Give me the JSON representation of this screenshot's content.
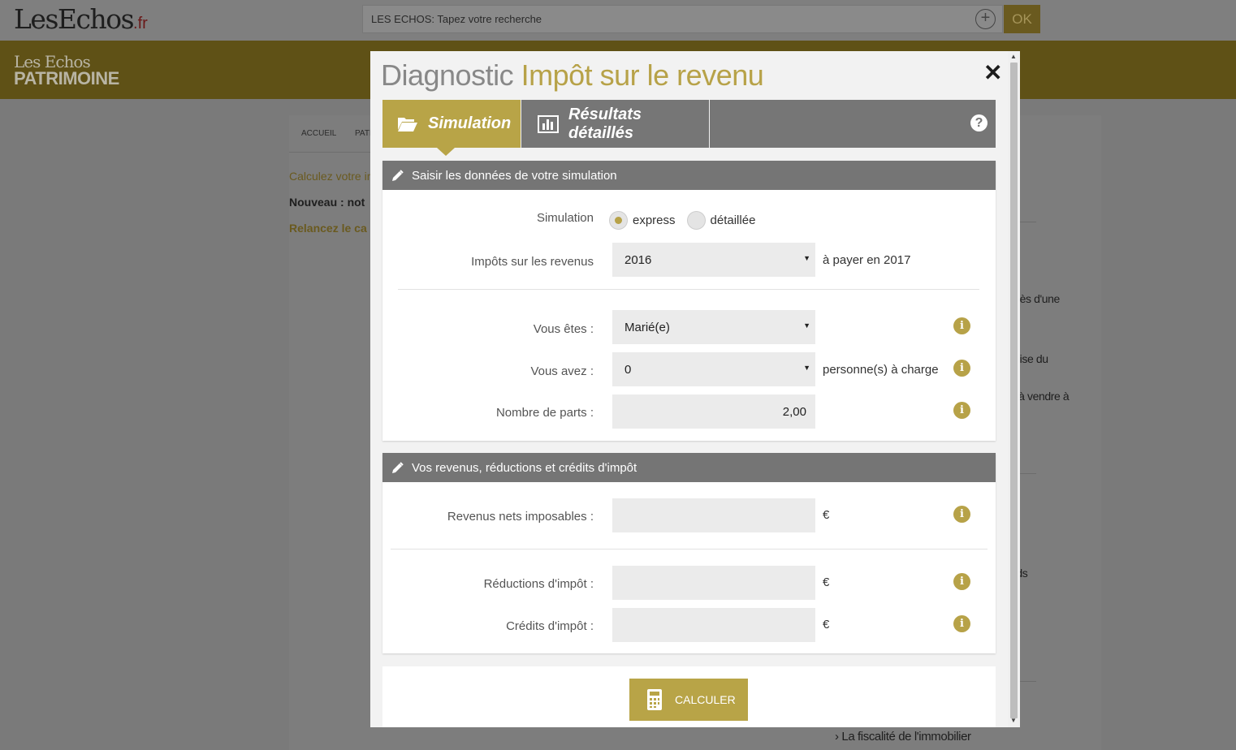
{
  "site": {
    "logo": "LesEchos",
    "logo_suffix": ".fr",
    "search_placeholder": "LES ECHOS: Tapez votre recherche",
    "ok_label": "OK",
    "section_logo_line1": "Les Echos",
    "section_logo_line2": "PATRIMOINE"
  },
  "background": {
    "breadcrumb": [
      "ACCUEIL",
      "PATR"
    ],
    "link_text": "Calculez votre in",
    "bold_text": "Nouveau : not",
    "relance_text": "Relancez le ca",
    "side_snippets": [
      "près d'une",
      "prise du",
      "s à vendre à",
      "nds"
    ],
    "bottom_link": "La fiscalité de l'immobilier"
  },
  "modal": {
    "title_part1": "Diagnostic",
    "title_part2": "Impôt sur le revenu",
    "tabs": [
      {
        "label": "Simulation",
        "active": true
      },
      {
        "label": "Résultats détaillés",
        "active": false
      }
    ],
    "section1": {
      "heading": "Saisir les données de votre simulation",
      "simulation_label": "Simulation",
      "simulation_options": [
        "express",
        "détaillée"
      ],
      "simulation_selected": "express",
      "impots_label": "Impôts sur les revenus",
      "impots_value": "2016",
      "impots_after": "à payer en 2017",
      "vous_etes_label": "Vous êtes :",
      "vous_etes_value": "Marié(e)",
      "vous_avez_label": "Vous avez :",
      "vous_avez_value": "0",
      "vous_avez_after": "personne(s) à charge",
      "parts_label": "Nombre de parts :",
      "parts_value": "2,00"
    },
    "section2": {
      "heading": "Vos revenus, réductions et crédits d'impôt",
      "revenus_label": "Revenus nets imposables :",
      "reductions_label": "Réductions d'impôt :",
      "credits_label": "Crédits d'impôt :",
      "currency": "€"
    },
    "calc_label": "CALCULER"
  },
  "colors": {
    "gold": "#b8a447",
    "header_gray": "#757575"
  }
}
